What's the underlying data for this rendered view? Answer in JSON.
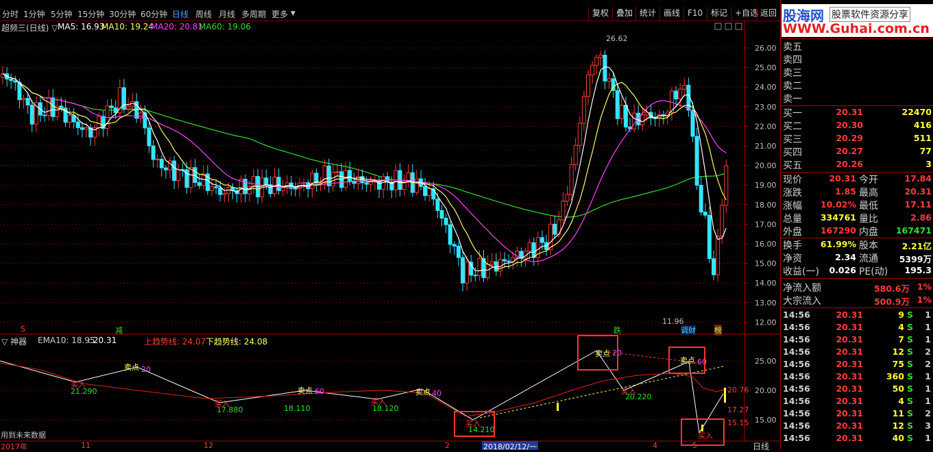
{
  "header": {
    "tabs": [
      "分时",
      "1分钟",
      "5分钟",
      "15分钟",
      "30分钟",
      "60分钟",
      "日线",
      "周线",
      "月线",
      "多周期",
      "更多"
    ],
    "active_tab": "日线",
    "right_buttons": [
      "复权",
      "叠加",
      "统计",
      "画线",
      "F10",
      "标记",
      "+自选",
      "返回"
    ]
  },
  "main_chart": {
    "title": "超频三(日线) ▽",
    "ma5": "MA5: 16.93",
    "ma10": "MA10: 19.24",
    "ma20": "MA20: 20.81",
    "ma60": "MA60: 19.06",
    "price_axis": [
      "26.00",
      "25.00",
      "24.00",
      "23.00",
      "22.00",
      "21.00",
      "20.00",
      "19.00",
      "18.00",
      "17.00",
      "16.00",
      "15.00",
      "14.00",
      "13.00",
      "12.00"
    ],
    "high_label": "26.62",
    "low_label": "11.96",
    "markers": {
      "s": "S",
      "jian": "减",
      "die": "跌",
      "jiecai": "调财",
      "bang": "榜"
    }
  },
  "indicator": {
    "title": "▽ 神器",
    "ema": "EMA10: 18.95",
    "ema_val": ": 20.31",
    "up_trend": "上趋势线: 24.07",
    "down_trend": "下趋势线: 24.08",
    "axis": [
      "25.00",
      "20.00",
      "15.00"
    ],
    "labels": {
      "buy": "买入",
      "sell": "卖点",
      "v1": "21.290",
      "v2": "17.880",
      "v3": "18.110",
      "v4": "18.120",
      "v5": "14.210",
      "v6": "20.220",
      "s1": "20",
      "s2": "60",
      "s3": "40",
      "s4": "20",
      "s5": "60",
      "r1": "20.76",
      "r2": "17.27",
      "r3": "15.15"
    },
    "footer": "用到未来数据"
  },
  "date_axis": {
    "labels": [
      "2017年",
      "11",
      "12",
      "2",
      "4",
      "5"
    ],
    "cursor": "2018/02/12/一",
    "period": "日线"
  },
  "logo": {
    "name": "股海网",
    "slogan": "股票软件资源分享",
    "url": "WWW.Guhai.com.cn"
  },
  "order_book": {
    "sells": [
      "卖五",
      "卖四",
      "卖三",
      "卖二",
      "卖一"
    ],
    "buys": [
      {
        "label": "买一",
        "price": "20.31",
        "vol": "22470"
      },
      {
        "label": "买二",
        "price": "20.30",
        "vol": "416"
      },
      {
        "label": "买三",
        "price": "20.29",
        "vol": "511"
      },
      {
        "label": "买四",
        "price": "20.27",
        "vol": "77"
      },
      {
        "label": "买五",
        "price": "20.26",
        "vol": "3"
      }
    ]
  },
  "quote": [
    {
      "l1": "现价",
      "v1": "20.31",
      "l2": "今开",
      "v2": "17.84"
    },
    {
      "l1": "涨跌",
      "v1": "1.85",
      "l2": "最高",
      "v2": "20.31"
    },
    {
      "l1": "涨幅",
      "v1": "10.02%",
      "l2": "最低",
      "v2": "17.11"
    },
    {
      "l1": "总量",
      "v1": "334761",
      "l2": "量比",
      "v2": "2.86"
    },
    {
      "l1": "外盘",
      "v1": "167290",
      "l2": "内盘",
      "v2": "167471"
    }
  ],
  "quote2": [
    {
      "l1": "换手",
      "v1": "61.99%",
      "l2": "股本",
      "v2": "2.21亿"
    },
    {
      "l1": "净资",
      "v1": "2.34",
      "l2": "流通",
      "v2": "5399万"
    },
    {
      "l1": "收益(一)",
      "v1": "0.026",
      "l2": "PE(动)",
      "v2": "195.3"
    }
  ],
  "flow": [
    {
      "l": "净流入额",
      "v": "580.6万",
      "p": "1%"
    },
    {
      "l": "大宗流入",
      "v": "500.9万",
      "p": "1%"
    }
  ],
  "ticks": [
    {
      "t": "14:56",
      "p": "20.31",
      "v": "9",
      "s": "S",
      "n": "1"
    },
    {
      "t": "14:56",
      "p": "20.31",
      "v": "4",
      "s": "S",
      "n": "1"
    },
    {
      "t": "14:56",
      "p": "20.31",
      "v": "7",
      "s": "S",
      "n": "1"
    },
    {
      "t": "14:56",
      "p": "20.31",
      "v": "12",
      "s": "S",
      "n": "2"
    },
    {
      "t": "14:56",
      "p": "20.31",
      "v": "75",
      "s": "S",
      "n": "2"
    },
    {
      "t": "14:56",
      "p": "20.31",
      "v": "360",
      "s": "S",
      "n": "1"
    },
    {
      "t": "14:56",
      "p": "20.31",
      "v": "50",
      "s": "S",
      "n": "1"
    },
    {
      "t": "14:56",
      "p": "20.31",
      "v": "4",
      "s": "S",
      "n": "1"
    },
    {
      "t": "14:56",
      "p": "20.31",
      "v": "11",
      "s": "S",
      "n": "2"
    },
    {
      "t": "14:56",
      "p": "20.31",
      "v": "12",
      "s": "S",
      "n": "3"
    },
    {
      "t": "14:56",
      "p": "20.31",
      "v": "40",
      "s": "S",
      "n": "1"
    }
  ],
  "colors": {
    "up": "#ff3b3b",
    "down": "#33e5ff",
    "ma5": "#ffffff",
    "ma10": "#ffff66",
    "ma20": "#ff44ff",
    "ma60": "#33dd33",
    "frame": "#b00000",
    "box": "#ff3333"
  }
}
